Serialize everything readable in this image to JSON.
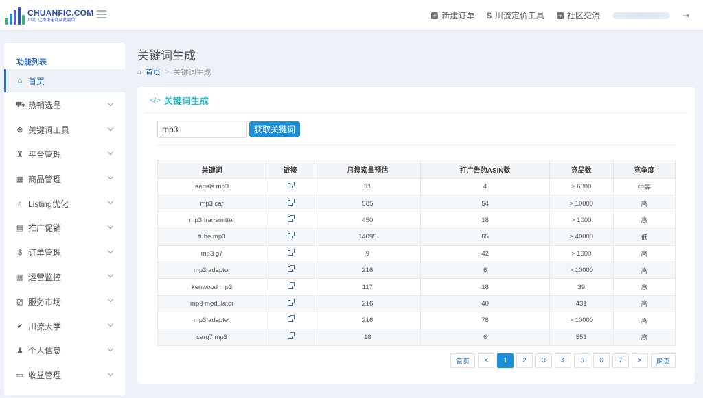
{
  "brand": {
    "name": "CHUANFIC.COM",
    "slogan": "川流, 让跨境电商从此简单!",
    "bar_colors": [
      "#36b37e",
      "#2a8ad6",
      "#5e62c9",
      "#2a55b8",
      "#36b37e"
    ]
  },
  "top_nav": {
    "new_order": "新建订单",
    "pricing_tool": "川流定价工具",
    "community": "社区交流"
  },
  "sidebar": {
    "title": "功能列表",
    "items": [
      {
        "label": "首页",
        "icon": "home-icon",
        "glyph": "⌂",
        "active": true,
        "has_children": false
      },
      {
        "label": "热销选品",
        "icon": "cart-icon",
        "glyph": "⛟",
        "active": false,
        "has_children": true
      },
      {
        "label": "关键词工具",
        "icon": "search-plus-icon",
        "glyph": "⊕",
        "active": false,
        "has_children": true
      },
      {
        "label": "平台管理",
        "icon": "binoculars-icon",
        "glyph": "♜",
        "active": false,
        "has_children": true
      },
      {
        "label": "商品管理",
        "icon": "grid-icon",
        "glyph": "▦",
        "active": false,
        "has_children": true
      },
      {
        "label": "Listing优化",
        "icon": "search-icon",
        "glyph": "⌕",
        "active": false,
        "has_children": true
      },
      {
        "label": "推广促销",
        "icon": "briefcase-icon",
        "glyph": "▤",
        "active": false,
        "has_children": true
      },
      {
        "label": "订单管理",
        "icon": "dollar-icon",
        "glyph": "$",
        "active": false,
        "has_children": true
      },
      {
        "label": "运营监控",
        "icon": "bar-chart-icon",
        "glyph": "▥",
        "active": false,
        "has_children": true
      },
      {
        "label": "服务市场",
        "icon": "map-icon",
        "glyph": "▧",
        "active": false,
        "has_children": true
      },
      {
        "label": "川流大学",
        "icon": "check-circle-icon",
        "glyph": "✔",
        "active": false,
        "has_children": true
      },
      {
        "label": "个人信息",
        "icon": "user-icon",
        "glyph": "♟",
        "active": false,
        "has_children": true
      },
      {
        "label": "收益管理",
        "icon": "credit-card-icon",
        "glyph": "▭",
        "active": false,
        "has_children": true
      }
    ]
  },
  "page": {
    "title": "关键词生成",
    "breadcrumb_home": "首页",
    "breadcrumb_current": "关键词生成"
  },
  "card": {
    "title": "关键词生成",
    "input_value": "mp3",
    "button_label": "获取关键词"
  },
  "table": {
    "headers": [
      "关键词",
      "链接",
      "月搜索量预估",
      "打广告的ASIN数",
      "竞品数",
      "竞争度"
    ],
    "rows": [
      {
        "keyword": "aerials mp3",
        "searches": "31",
        "ad_asins": "4",
        "competitors": "> 6000",
        "competition": "中等"
      },
      {
        "keyword": "mp3 car",
        "searches": "585",
        "ad_asins": "54",
        "competitors": "> 10000",
        "competition": "高"
      },
      {
        "keyword": "mp3 transmitter",
        "searches": "450",
        "ad_asins": "18",
        "competitors": "> 1000",
        "competition": "高"
      },
      {
        "keyword": "tube mp3",
        "searches": "14895",
        "ad_asins": "65",
        "competitors": "> 40000",
        "competition": "低"
      },
      {
        "keyword": "mp3 g7",
        "searches": "9",
        "ad_asins": "42",
        "competitors": "> 1000",
        "competition": "高"
      },
      {
        "keyword": "mp3 adaptor",
        "searches": "216",
        "ad_asins": "6",
        "competitors": "> 10000",
        "competition": "高"
      },
      {
        "keyword": "kenwood mp3",
        "searches": "117",
        "ad_asins": "18",
        "competitors": "39",
        "competition": "高"
      },
      {
        "keyword": "mp3 modulator",
        "searches": "216",
        "ad_asins": "40",
        "competitors": "431",
        "competition": "高"
      },
      {
        "keyword": "mp3 adapter",
        "searches": "216",
        "ad_asins": "78",
        "competitors": "> 10000",
        "competition": "高"
      },
      {
        "keyword": "carg7 mp3",
        "searches": "18",
        "ad_asins": "6",
        "competitors": "551",
        "competition": "高"
      }
    ]
  },
  "pagination": {
    "first": "首页",
    "prev": "<",
    "pages": [
      "1",
      "2",
      "3",
      "4",
      "5",
      "6",
      "7"
    ],
    "current": "1",
    "next": ">",
    "last": "尾页"
  }
}
